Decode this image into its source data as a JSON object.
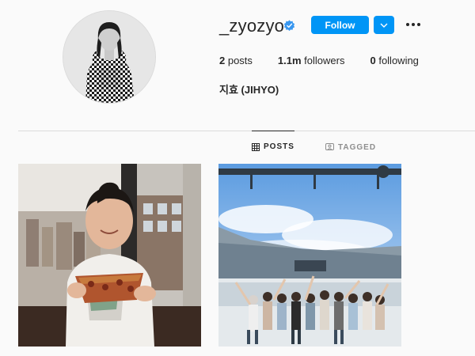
{
  "profile": {
    "username": "_zyozyo",
    "verified": true,
    "display_name": "지효 (JIHYO)",
    "follow_label": "Follow",
    "avatar_icon": "profile-photo"
  },
  "stats": {
    "posts_count": "2",
    "posts_label": " posts",
    "followers_count": "1.1m",
    "followers_label": " followers",
    "following_count": "0",
    "following_label": " following"
  },
  "tabs": [
    {
      "label": "POSTS",
      "icon": "grid-icon",
      "active": true
    },
    {
      "label": "TAGGED",
      "icon": "tag-icon",
      "active": false
    }
  ],
  "colors": {
    "accent": "#0095f6",
    "background": "#fafafa",
    "text": "#262626",
    "muted": "#8e8e8e",
    "divider": "#dbdbdb"
  }
}
